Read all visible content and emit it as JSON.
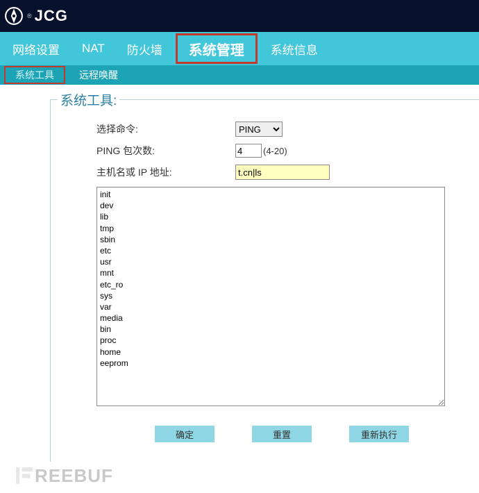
{
  "brand": "JCG",
  "mainnav": {
    "items": [
      {
        "label": "网络设置"
      },
      {
        "label": "NAT"
      },
      {
        "label": "防火墙"
      },
      {
        "label": "系统管理"
      },
      {
        "label": "系统信息"
      }
    ],
    "active_index": 3
  },
  "subnav": {
    "items": [
      {
        "label": "系统工具"
      },
      {
        "label": "远程唤醒"
      }
    ],
    "active_index": 0
  },
  "panel": {
    "legend": "系统工具:",
    "rows": {
      "cmd_label": "选择命令:",
      "cmd_value": "PING",
      "count_label": "PING 包次数:",
      "count_value": "4",
      "count_hint": "(4-20)",
      "host_label": "主机名或 IP 地址:",
      "host_value": "t.cn|ls"
    },
    "output": "init\ndev\nlib\ntmp\nsbin\netc\nusr\nmnt\netc_ro\nsys\nvar\nmedia\nbin\nproc\nhome\neeprom",
    "buttons": {
      "ok": "确定",
      "reset": "重置",
      "rerun": "重新执行"
    }
  },
  "watermark": "REEBUF"
}
